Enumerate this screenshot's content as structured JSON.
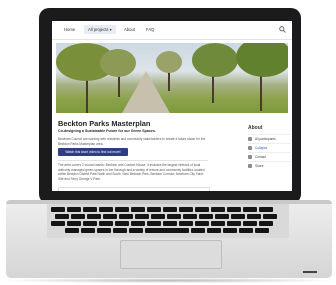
{
  "nav": {
    "items": [
      "Home",
      "All projects ▾",
      "About",
      "FAQ"
    ],
    "active_index": 1,
    "search_icon": "search-icon"
  },
  "hero": {
    "scene": "tree-lined avenue in a park"
  },
  "content": {
    "title": "Beckton Parks Masterplan",
    "subtitle": "Co-designing a Sustainable Future for our Green Spaces.",
    "intro": "Newham Council are working with residents and community stakeholders to create a future vision for the Beckton Parks Masterplan area.",
    "cta_label": "Watch this short video to find out more!",
    "body": "The area covers 2 council wards: Beckton and Custom House. It includes the largest network of local authority managed green spaces in the borough and a variety of leisure and community facilities located within Beckton District Park North and South, New Beckton Park, Beckton Corridor, Newham City Farm Site and Ferry George V Park."
  },
  "sidebar": {
    "title": "About",
    "items": [
      {
        "label": "Ali participants",
        "icon": "person-icon",
        "link": false
      },
      {
        "label": "Collapse",
        "icon": "collapse-icon",
        "link": true
      },
      {
        "label": "Contact",
        "icon": "envelope-icon",
        "link": false
      },
      {
        "label": "Share",
        "icon": "share-icon",
        "link": false
      }
    ]
  },
  "colors": {
    "cta_bg": "#2f3d84",
    "bezel": "#1b1b1d",
    "laptop_body": "#dcdcdc",
    "link": "#3a5fc8"
  }
}
